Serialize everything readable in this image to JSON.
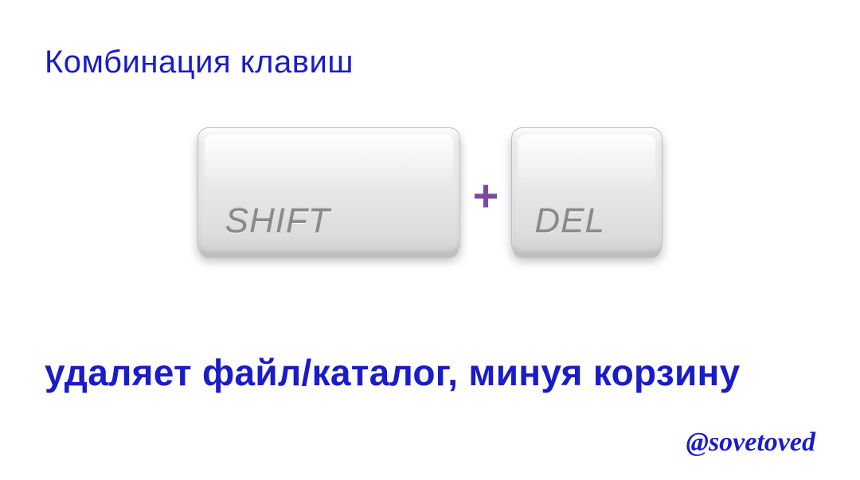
{
  "heading": "Комбинация клавиш",
  "keys": {
    "shift": "SHIFT",
    "del": "DEL",
    "plus": "+"
  },
  "description": "удаляет файл/каталог, минуя корзину",
  "handle": "@sovetoved"
}
